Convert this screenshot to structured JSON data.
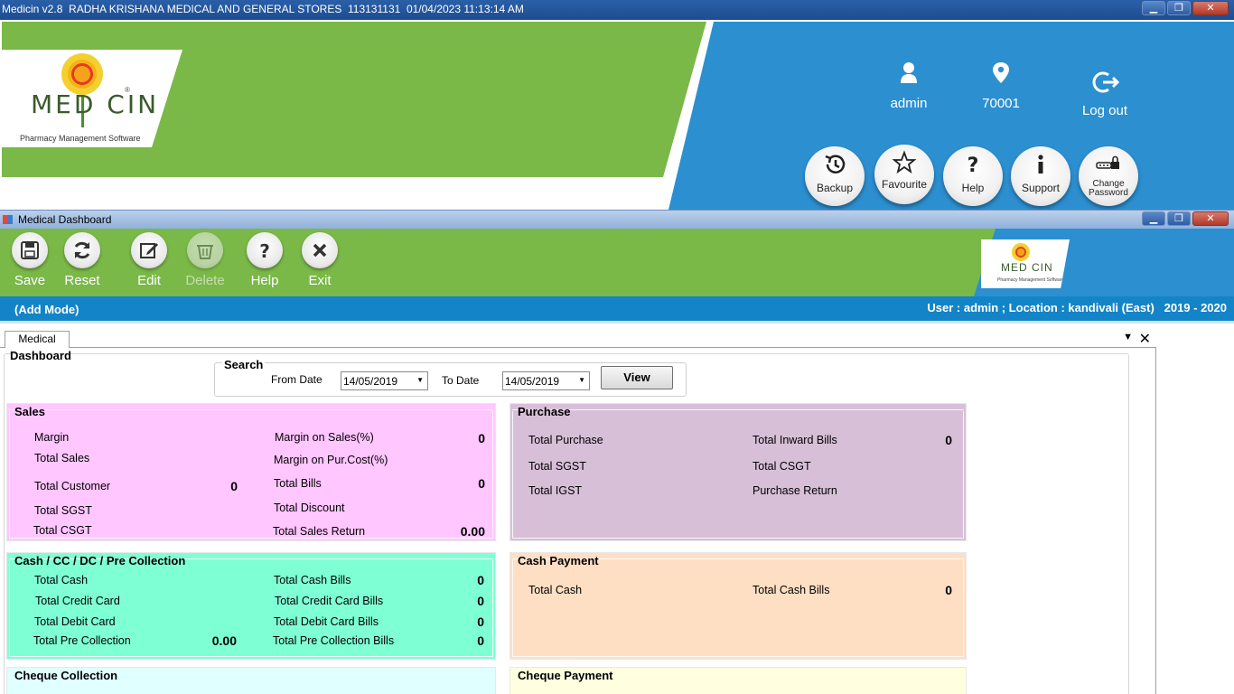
{
  "window": {
    "title": "Medicin v2.8  RADHA KRISHANA MEDICAL AND GENERAL STORES  113131131  01/04/2023 11:13:14 AM",
    "controls": {
      "minimize": "▁",
      "maximize": "❐",
      "close": "✕"
    }
  },
  "header": {
    "logo": {
      "word": "MED CIN",
      "registered": "®",
      "subtitle": "Pharmacy Management Software"
    },
    "user": {
      "label": "admin",
      "icon": "user-icon"
    },
    "location": {
      "label": "70001",
      "icon": "location-pin-icon"
    },
    "logout": {
      "label": "Log out",
      "icon": "logout-icon"
    },
    "buttons": [
      {
        "label": "Backup",
        "icon": "history-icon"
      },
      {
        "label": "Favourite",
        "icon": "star-icon"
      },
      {
        "label": "Help",
        "icon": "question-icon"
      },
      {
        "label": "Support",
        "icon": "info-icon"
      },
      {
        "label": "Change Password",
        "icon": "password-lock-icon"
      }
    ],
    "colors": {
      "green": "#7ab848",
      "blue": "#2c8fd0"
    }
  },
  "child_window": {
    "title": "Medical Dashboard"
  },
  "toolbar": {
    "buttons": [
      {
        "label": "Save",
        "icon": "save-icon",
        "enabled": true
      },
      {
        "label": "Reset",
        "icon": "refresh-icon",
        "enabled": true
      },
      {
        "label": "Edit",
        "icon": "edit-icon",
        "enabled": true
      },
      {
        "label": "Delete",
        "icon": "trash-icon",
        "enabled": false
      },
      {
        "label": "Help",
        "icon": "question-icon",
        "enabled": true
      },
      {
        "label": "Exit",
        "icon": "close-icon",
        "enabled": true
      }
    ]
  },
  "mode_bar": {
    "mode": "(Add Mode)",
    "info": "User : admin ; Location : kandivali (East)   2019 - 2020"
  },
  "tabs": {
    "active": "Medical",
    "dropdown": "▼",
    "close": "✕"
  },
  "dashboard": {
    "title": "Dashboard",
    "search": {
      "legend": "Search",
      "from_label": "From Date",
      "from_value": "14/05/2019",
      "to_label": "To Date",
      "to_value": "14/05/2019",
      "view_label": "View"
    },
    "sales": {
      "title": "Sales",
      "margin": "Margin",
      "total_sales": "Total Sales",
      "total_customer": "Total Customer",
      "total_customer_value": "0",
      "total_sgst": "Total SGST",
      "total_csgt": "Total CSGT",
      "margin_on_sales": "Margin on Sales(%)",
      "margin_on_sales_value": "0",
      "margin_on_pur": "Margin on Pur.Cost(%)",
      "total_bills": "Total Bills",
      "total_bills_value": "0",
      "total_discount": "Total Discount",
      "total_sales_return": "Total Sales Return",
      "total_sales_return_value": "0.00"
    },
    "purchase": {
      "title": "Purchase",
      "total_purchase": "Total Purchase",
      "total_sgst": "Total SGST",
      "total_igst": "Total IGST",
      "total_inward_bills": "Total Inward Bills",
      "total_inward_bills_value": "0",
      "total_csgt": "Total CSGT",
      "purchase_return": "Purchase Return"
    },
    "cash_collection": {
      "title": "Cash / CC / DC / Pre Collection",
      "total_cash": "Total Cash",
      "total_credit_card": "Total Credit Card",
      "total_debit_card": "Total Debit Card",
      "total_pre_collection": "Total Pre Collection",
      "total_pre_collection_value": "0.00",
      "total_cash_bills": "Total Cash Bills",
      "total_cash_bills_value": "0",
      "total_credit_card_bills": "Total Credit Card Bills",
      "total_credit_card_bills_value": "0",
      "total_debit_card_bills": "Total Debit Card Bills",
      "total_debit_card_bills_value": "0",
      "total_pre_collection_bills": "Total Pre Collection Bills",
      "total_pre_collection_bills_value": "0"
    },
    "cash_payment": {
      "title": "Cash Payment",
      "total_cash": "Total Cash",
      "total_cash_bills": "Total Cash Bills",
      "total_cash_bills_value": "0"
    },
    "cheque_collection": {
      "title": "Cheque Collection"
    },
    "cheque_payment": {
      "title": "Cheque Payment"
    }
  }
}
